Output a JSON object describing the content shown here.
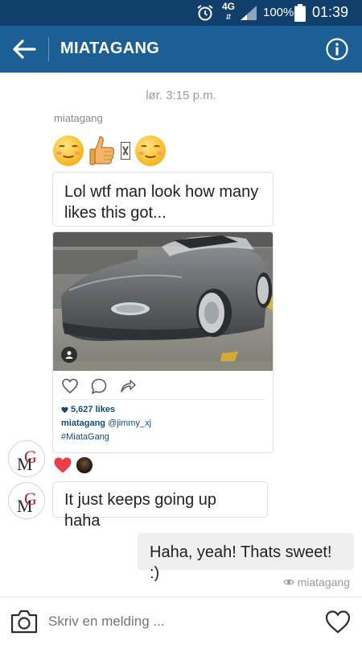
{
  "status_bar": {
    "network": "4G",
    "battery_percent": "100%",
    "time": "01:39",
    "icons": [
      "alarm-icon",
      "signal-icon",
      "battery-icon"
    ]
  },
  "header": {
    "title": "MIATAGANG",
    "back_icon": "arrow-left-icon",
    "info_icon": "info-icon",
    "colors": {
      "status_bar": "#0f3f6a",
      "app_bar": "#1c5f95"
    }
  },
  "thread": {
    "timestamp": "lør. 3:15 p.m.",
    "sender_name": "miatagang",
    "emoji_message": [
      "smiling-face-emoji",
      "thumbs-up-emoji",
      "missing-glyph",
      "smiling-face-emoji"
    ],
    "message_1": "Lol wtf man look how many likes this got...",
    "shared_post": {
      "likes": "5,627 likes",
      "username": "miatagang",
      "mention": "@jimmy_xj",
      "hashtag": "#MiataGang"
    },
    "reactions": [
      "heart-icon",
      "reactor-avatar"
    ],
    "message_2": "It just keeps going up haha",
    "reply": "Haha, yeah! Thats sweet! :)",
    "seen_by": "miatagang"
  },
  "composer": {
    "placeholder": "Skriv en melding ...",
    "camera_icon": "camera-icon",
    "like_icon": "heart-outline-icon"
  }
}
